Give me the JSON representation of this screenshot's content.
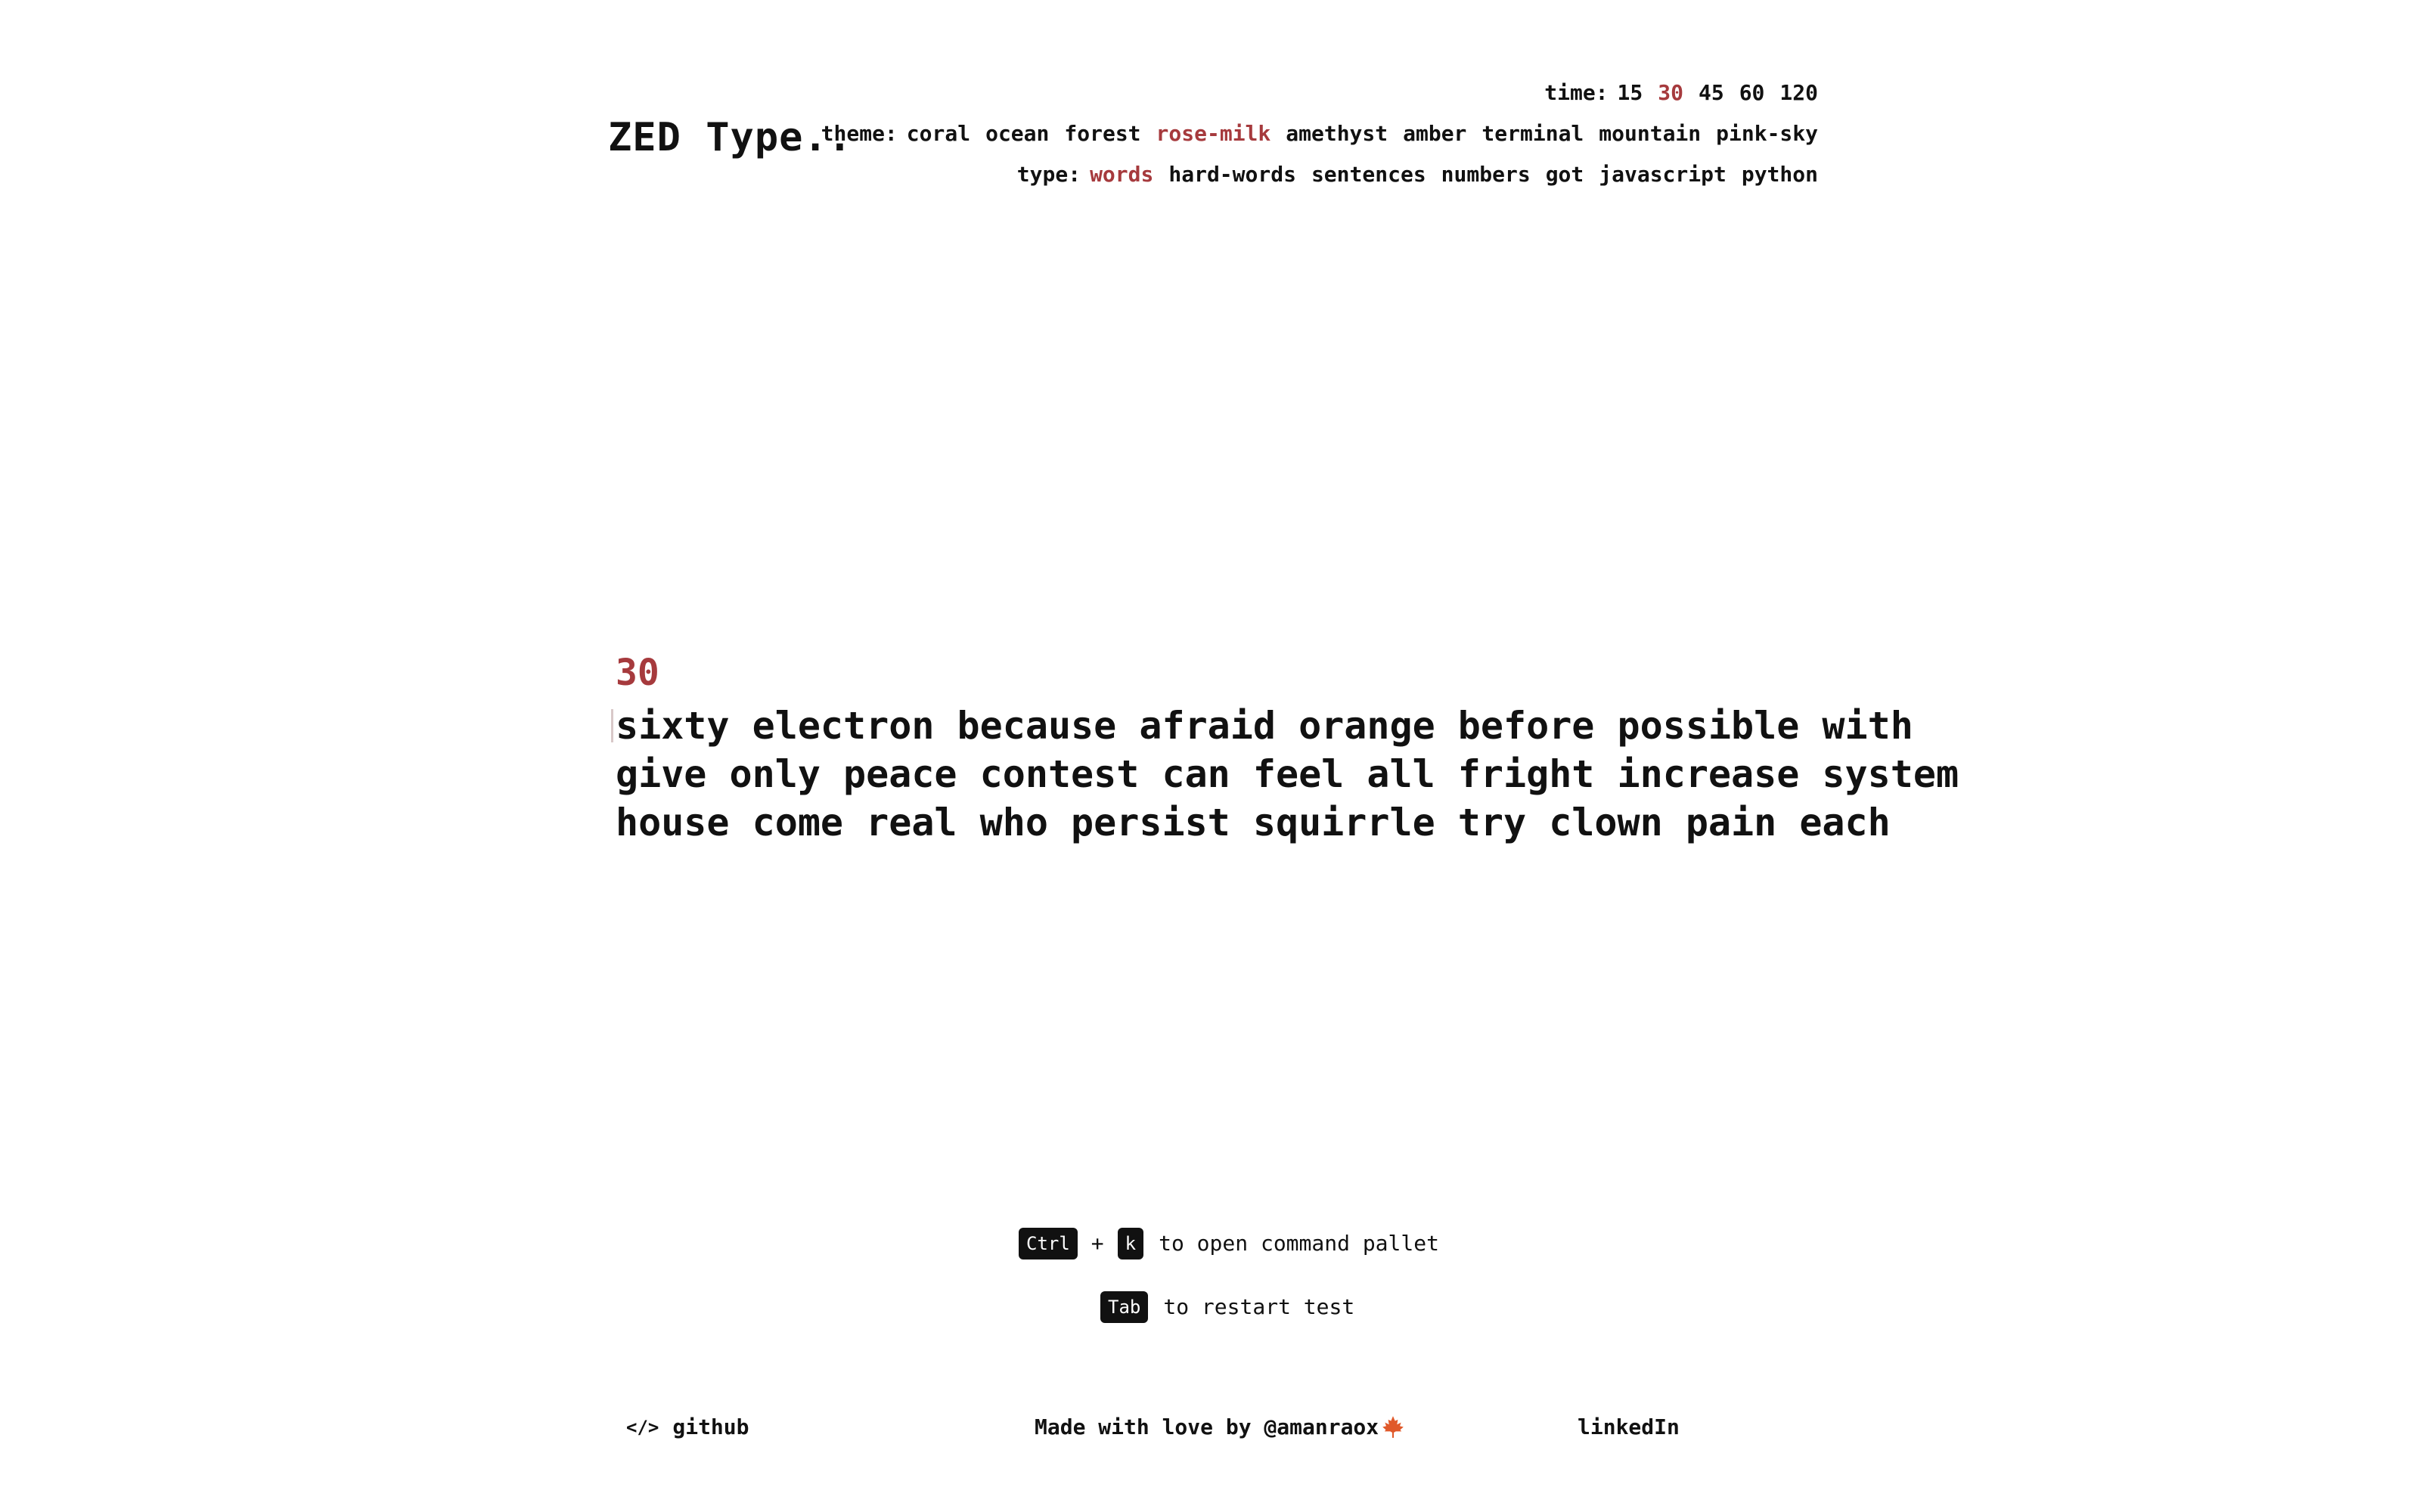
{
  "app": {
    "logo": "ZED Type.."
  },
  "options": {
    "time": {
      "label": "time:",
      "items": [
        "15",
        "30",
        "45",
        "60",
        "120"
      ],
      "selected": "30"
    },
    "theme": {
      "label": "theme:",
      "items": [
        "coral",
        "ocean",
        "forest",
        "rose-milk",
        "amethyst",
        "amber",
        "terminal",
        "mountain",
        "pink-sky"
      ],
      "selected": "rose-milk"
    },
    "type": {
      "label": "type:",
      "items": [
        "words",
        "hard-words",
        "sentences",
        "numbers",
        "got",
        "javascript",
        "python"
      ],
      "selected": "words"
    }
  },
  "test": {
    "timer": "30",
    "lines": [
      "sixty electron because afraid orange before possible with",
      "give only peace contest can feel all fright increase system",
      "house come real who persist squirrle try clown pain each"
    ]
  },
  "hints": {
    "ctrl_key": "Ctrl",
    "plus": "+",
    "k_key": "k",
    "command_text": "to open command pallet",
    "tab_key": "Tab",
    "restart_text": "to restart test"
  },
  "footer": {
    "code_symbol": "</>",
    "github": "github",
    "made_with": "Made with love by @amanraox",
    "linkedin": "linkedIn"
  },
  "colors": {
    "accent": "#a63a3d",
    "text": "#111111",
    "background": "#ffffff",
    "leaf": "#e0592a"
  },
  "icons": {
    "code": "code-icon",
    "leaf": "maple-leaf-icon"
  }
}
